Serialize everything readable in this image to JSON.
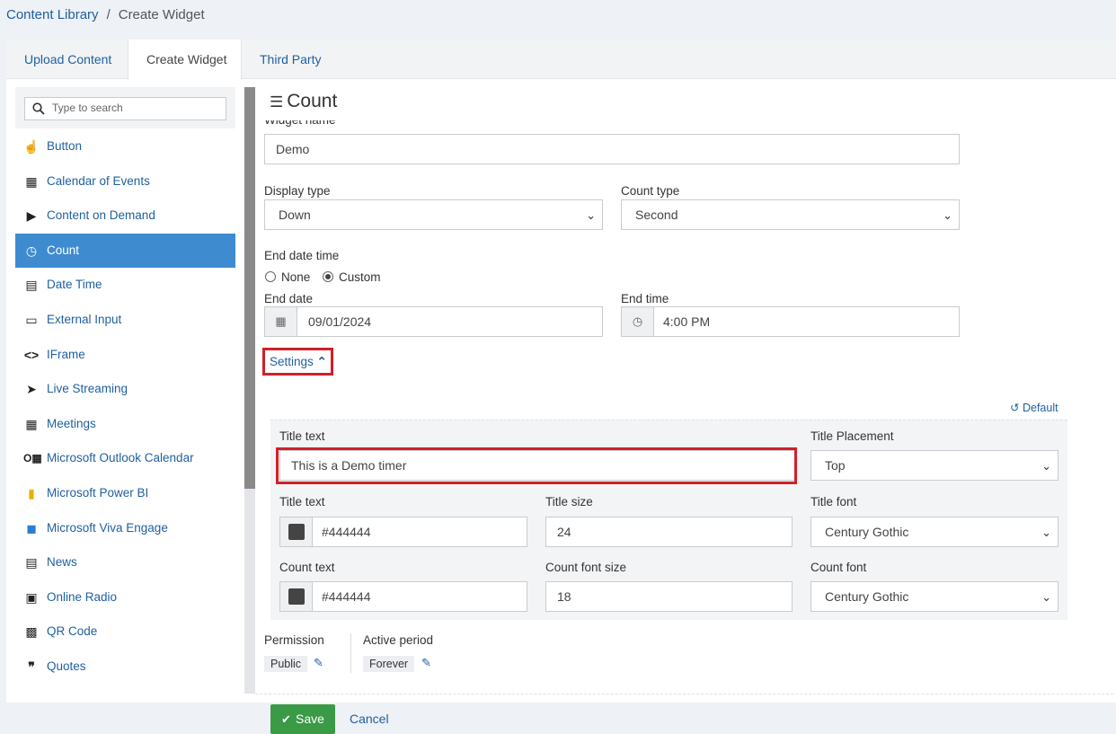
{
  "breadcrumb": {
    "root": "Content Library",
    "separator": "/",
    "current": "Create Widget"
  },
  "tabs": [
    {
      "label": "Upload Content"
    },
    {
      "label": "Create Widget"
    },
    {
      "label": "Third Party"
    }
  ],
  "sidebar": {
    "search_placeholder": "Type to search",
    "items": [
      {
        "label": "Button",
        "icon": "hand-pointer-icon"
      },
      {
        "label": "Calendar of Events",
        "icon": "calendar-icon"
      },
      {
        "label": "Content on Demand",
        "icon": "play-circle-icon"
      },
      {
        "label": "Count",
        "icon": "stopwatch-icon"
      },
      {
        "label": "Date Time",
        "icon": "calendar-clock-icon"
      },
      {
        "label": "External Input",
        "icon": "keyboard-icon"
      },
      {
        "label": "IFrame",
        "icon": "code-icon"
      },
      {
        "label": "Live Streaming",
        "icon": "broadcast-icon"
      },
      {
        "label": "Meetings",
        "icon": "calendar-grid-icon"
      },
      {
        "label": "Microsoft Outlook Calendar",
        "icon": "outlook-icon"
      },
      {
        "label": "Microsoft Power BI",
        "icon": "power-bi-icon"
      },
      {
        "label": "Microsoft Viva Engage",
        "icon": "viva-engage-icon"
      },
      {
        "label": "News",
        "icon": "newspaper-icon"
      },
      {
        "label": "Online Radio",
        "icon": "radio-icon"
      },
      {
        "label": "QR Code",
        "icon": "qr-code-icon"
      },
      {
        "label": "Quotes",
        "icon": "quote-icon"
      }
    ]
  },
  "form": {
    "heading": "Count",
    "widget_name_label": "Widget name",
    "widget_name_value": "Demo",
    "display_type_label": "Display type",
    "display_type_value": "Down",
    "count_type_label": "Count type",
    "count_type_value": "Second",
    "end_date_time_label": "End date time",
    "radio_none": "None",
    "radio_custom": "Custom",
    "end_date_label": "End date",
    "end_date_value": "09/01/2024",
    "end_time_label": "End time",
    "end_time_value": "4:00 PM",
    "settings_label": "Settings",
    "default_label": "Default",
    "settings": {
      "title_text_label": "Title text",
      "title_text_value": "This is a Demo timer",
      "title_placement_label": "Title Placement",
      "title_placement_value": "Top",
      "title_color_label": "Title text",
      "title_color_value": "#444444",
      "title_size_label": "Title size",
      "title_size_value": "24",
      "title_font_label": "Title font",
      "title_font_value": "Century Gothic",
      "count_color_label": "Count text",
      "count_color_value": "#444444",
      "count_font_size_label": "Count font size",
      "count_font_size_value": "18",
      "count_font_label": "Count font",
      "count_font_value": "Century Gothic"
    },
    "permission_label": "Permission",
    "permission_value": "Public",
    "active_period_label": "Active period",
    "active_period_value": "Forever",
    "save_label": "Save",
    "cancel_label": "Cancel"
  },
  "colors": {
    "accent": "#3f8bd0",
    "link": "#1f5f9f",
    "save": "#3a9a46",
    "highlight": "#d0202a"
  }
}
